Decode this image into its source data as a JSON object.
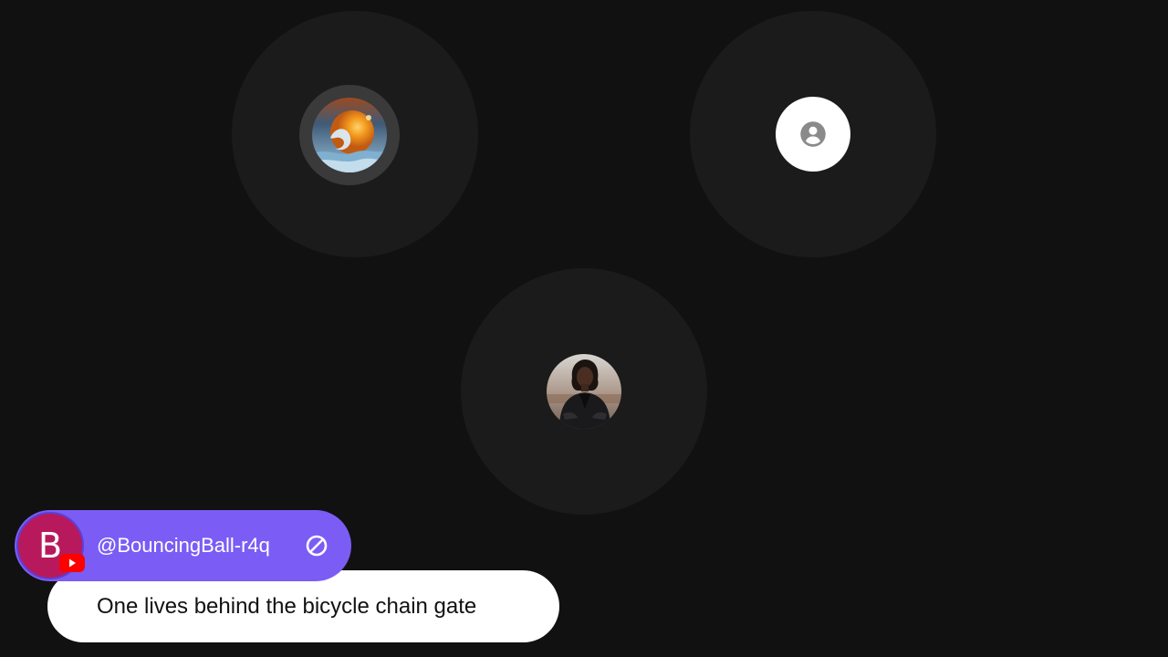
{
  "participants": [
    {
      "icon": "fire-water-orb-avatar",
      "speaking_ring": true
    },
    {
      "icon": "default-user-avatar",
      "speaking_ring": false
    },
    {
      "icon": "woman-leather-jacket-avatar",
      "speaking_ring": false
    }
  ],
  "chat": {
    "author_initial": "B",
    "author_name": "@BouncingBall-r4q",
    "platform_icon": "youtube-icon",
    "badge_icon": "moderator-slash-icon",
    "message": "One lives behind the bicycle chain gate"
  },
  "colors": {
    "background": "#111111",
    "tile": "#1b1b1b",
    "name_pill": "#7b5cf5",
    "author_avatar": "#b8195d",
    "youtube_red": "#ff0000",
    "bubble": "#ffffff"
  }
}
